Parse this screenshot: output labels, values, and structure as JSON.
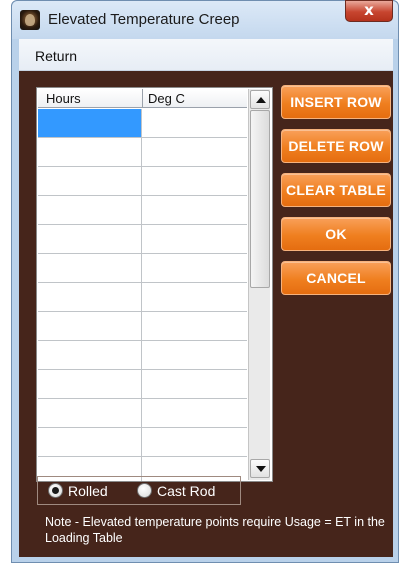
{
  "window": {
    "title": "Elevated Temperature Creep",
    "close_glyph": "x"
  },
  "menu": {
    "items": [
      "Return"
    ]
  },
  "table": {
    "columns": [
      "Hours",
      "Deg C"
    ],
    "rows": [
      [
        "",
        ""
      ],
      [
        "",
        ""
      ],
      [
        "",
        ""
      ],
      [
        "",
        ""
      ],
      [
        "",
        ""
      ],
      [
        "",
        ""
      ],
      [
        "",
        ""
      ],
      [
        "",
        ""
      ],
      [
        "",
        ""
      ],
      [
        "",
        ""
      ],
      [
        "",
        ""
      ],
      [
        "",
        ""
      ],
      [
        "",
        ""
      ]
    ],
    "selected_cell": {
      "row": 0,
      "col": 0
    }
  },
  "buttons": {
    "insert_row": "INSERT ROW",
    "delete_row": "DELETE ROW",
    "clear_table": "CLEAR TABLE",
    "ok": "OK",
    "cancel": "CANCEL"
  },
  "radio": {
    "options": [
      "Rolled",
      "Cast Rod"
    ],
    "selected": "Rolled"
  },
  "note": "Note - Elevated temperature points require Usage = ET in the Loading Table",
  "colors": {
    "client_background": "#46251b",
    "button_orange": "#ef7f1f",
    "selection": "#3399ff"
  },
  "icons": {
    "app": "app-icon",
    "close": "close-icon",
    "scroll_up": "chevron-up-icon",
    "scroll_down": "chevron-down-icon"
  }
}
